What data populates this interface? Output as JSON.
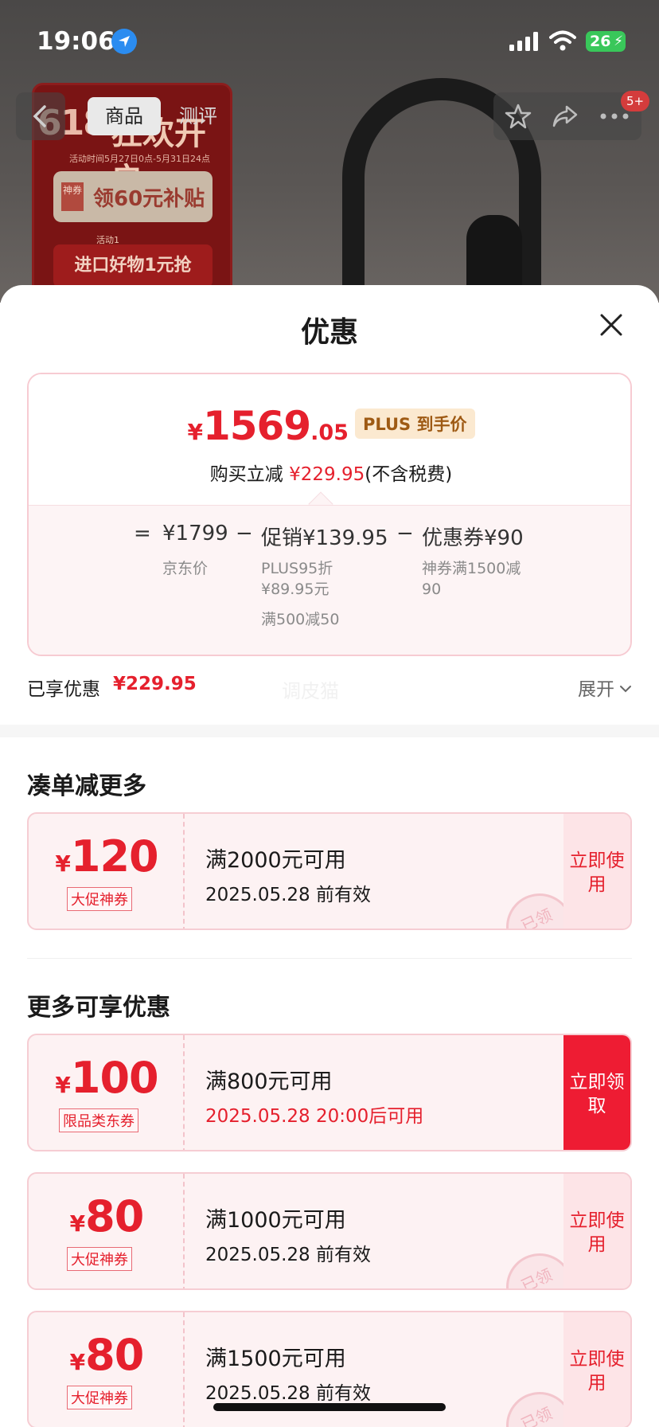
{
  "status_bar": {
    "time": "19:06",
    "battery": "26"
  },
  "background": {
    "promo_618": "618",
    "promo_headline": "狂欢开启",
    "promo_time": "活动时间5月27日0点-5月31日24点",
    "promo_coupon_tag": "神券",
    "promo_coupon_text": "领60元补贴",
    "promo_activity": "活动1",
    "promo_banner": "进口好物1元抢"
  },
  "nav": {
    "tab_product": "商品",
    "tab_review": "测评",
    "badge": "5+"
  },
  "sheet": {
    "title": "优惠",
    "price": {
      "yen": "¥",
      "integer": "1569",
      "decimal": ".05",
      "plus_tag": "PLUS 到手价",
      "reduce_prefix": "购买立减",
      "reduce_amount": "¥229.95",
      "reduce_suffix": "(不含税费)"
    },
    "formula": {
      "equals": "=",
      "base": "¥1799",
      "base_label": "京东价",
      "minus1": "−",
      "promo": "促销¥139.95",
      "promo_detail1": "PLUS95折",
      "promo_detail2": "¥89.95元",
      "promo_detail3": "满500减50",
      "minus2": "−",
      "coupon": "优惠券¥90",
      "coupon_detail1": "神券满1500减",
      "coupon_detail2": "90"
    },
    "saved": {
      "label": "已享优惠",
      "amount": "¥229.95",
      "watermark": "调皮猫",
      "expand": "展开"
    },
    "section1_title": "凑单减更多",
    "section2_title": "更多可享优惠",
    "coupons_top": [
      {
        "yen": "¥",
        "amount": "120",
        "tag": "大促神券",
        "condition": "满2000元可用",
        "validity": "2025.05.28 前有效",
        "button": "立即使用",
        "stamp": "已领"
      }
    ],
    "coupons_more": [
      {
        "yen": "¥",
        "amount": "100",
        "tag": "限品类东券",
        "condition": "满800元可用",
        "validity": "2025.05.28 20:00后可用",
        "button": "立即领取"
      },
      {
        "yen": "¥",
        "amount": "80",
        "tag": "大促神券",
        "condition": "满1000元可用",
        "validity": "2025.05.28 前有效",
        "button": "立即使用",
        "stamp": "已领"
      },
      {
        "yen": "¥",
        "amount": "80",
        "tag": "大促神券",
        "condition": "满1500元可用",
        "validity": "2025.05.28 前有效",
        "button": "立即使用",
        "stamp": "已领"
      }
    ]
  },
  "colors": {
    "accent_red": "#e5202d",
    "solid_button": "#ee1c33",
    "plus_gold": "#9e5a14"
  }
}
